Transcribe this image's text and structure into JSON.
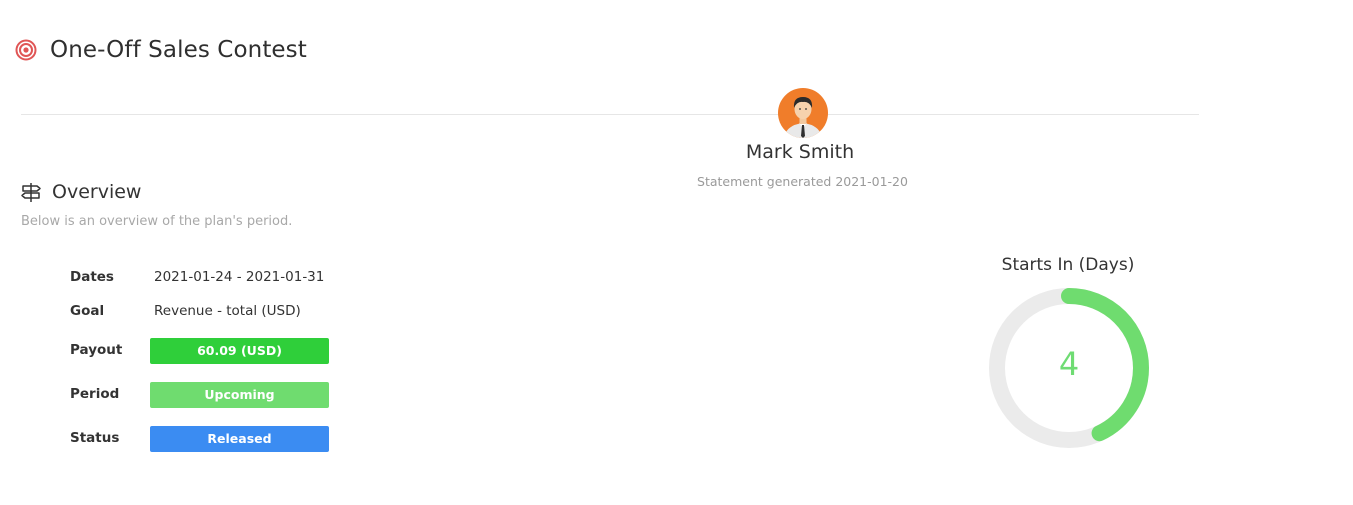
{
  "header": {
    "title": "One-Off Sales Contest",
    "icon": "target-icon",
    "icon_color": "#e05555"
  },
  "profile": {
    "name": "Mark Smith",
    "statement": "Statement generated 2021-01-20",
    "avatar_bg": "#f07d2a"
  },
  "overview": {
    "heading": "Overview",
    "icon": "signpost-icon",
    "description": "Below is an overview of the plan's period.",
    "rows": [
      {
        "label": "Dates",
        "value": "2021-01-24 - 2021-01-31"
      },
      {
        "label": "Goal",
        "value": "Revenue - total (USD)"
      },
      {
        "label": "Payout",
        "value": "60.09 (USD)",
        "color": "#2fcf3a"
      },
      {
        "label": "Period",
        "value": "Upcoming",
        "color": "#6fdc6f"
      },
      {
        "label": "Status",
        "value": "Released",
        "color": "#3b8cf2"
      }
    ]
  },
  "gauge": {
    "title": "Starts In (Days)",
    "value": "4",
    "fraction": 0.43,
    "track_color": "#ebebeb",
    "fill_color": "#6fdc6f"
  }
}
